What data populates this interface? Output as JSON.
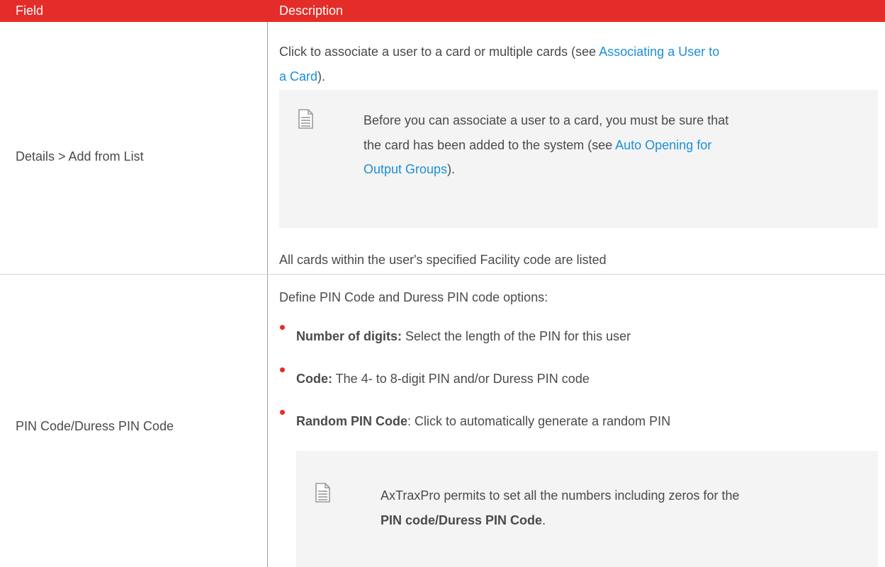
{
  "header": {
    "field": "Field",
    "description": "Description"
  },
  "rows": [
    {
      "field": "Details > Add from List",
      "desc_line1_pre": "Click to associate a user to a card or multiple cards (see ",
      "desc_link": "Associating a User to",
      "desc_link2": "a Card",
      "desc_line2_post": ").",
      "note_line1": "Before you can associate a user to a card, you must be sure that",
      "note_line2_pre": "the card has been added to the system (see ",
      "note_link1": "Auto Opening for",
      "note_link2": "Output Groups",
      "note_line3_post": ").",
      "footer": "All cards within the user's specified Facility code are listed"
    },
    {
      "field": "PIN Code/Duress PIN Code",
      "intro": "Define PIN Code and Duress PIN code options:",
      "bullets": [
        {
          "label": "Number of digits:",
          "text": " Select the length of the PIN for this user"
        },
        {
          "label": "Code:",
          "text": " The 4- to 8-digit PIN and/or Duress PIN code"
        },
        {
          "label": "Random PIN Code",
          "text": ": Click to automatically generate a random PIN"
        }
      ],
      "note_line1": "AxTraxPro permits to set all the numbers including zeros for the",
      "note_bold": "PIN code/Duress PIN Code",
      "note_end": "."
    }
  ],
  "colors": {
    "header_bg": "#e42d28",
    "link": "#1a8fdb",
    "note_bg": "#f4f4f4"
  },
  "icons": [
    "document-icon"
  ]
}
